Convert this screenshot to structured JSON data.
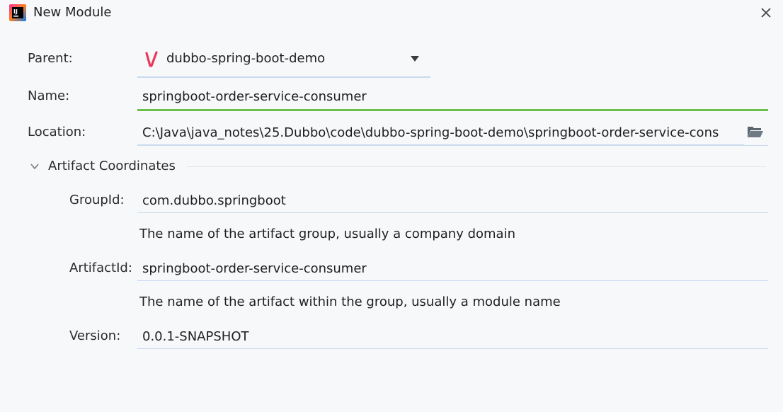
{
  "window": {
    "title": "New Module",
    "icon": "intellij-logo-icon",
    "close_icon": "close-icon"
  },
  "form": {
    "parent": {
      "label": "Parent:",
      "value": "dubbo-spring-boot-demo",
      "icon": "maven-icon"
    },
    "name": {
      "label": "Name:",
      "value": "springboot-order-service-consumer"
    },
    "location": {
      "label": "Location:",
      "value": "C:\\Java\\java_notes\\25.Dubbo\\code\\dubbo-spring-boot-demo\\springboot-order-service-cons",
      "icon": "folder-open-icon"
    }
  },
  "artifact": {
    "section_title": "Artifact Coordinates",
    "group_id": {
      "label": "GroupId:",
      "value": "com.dubbo.springboot",
      "hint": "The name of the artifact group, usually a company domain"
    },
    "artifact_id": {
      "label": "ArtifactId:",
      "value": "springboot-order-service-consumer",
      "hint": "The name of the artifact within the group, usually a module name"
    },
    "version": {
      "label": "Version:",
      "value": "0.0.1-SNAPSHOT"
    }
  },
  "colors": {
    "active_underline": "#6cc04a",
    "field_underline": "#c8daf0",
    "maven_red": "#e8385a"
  }
}
